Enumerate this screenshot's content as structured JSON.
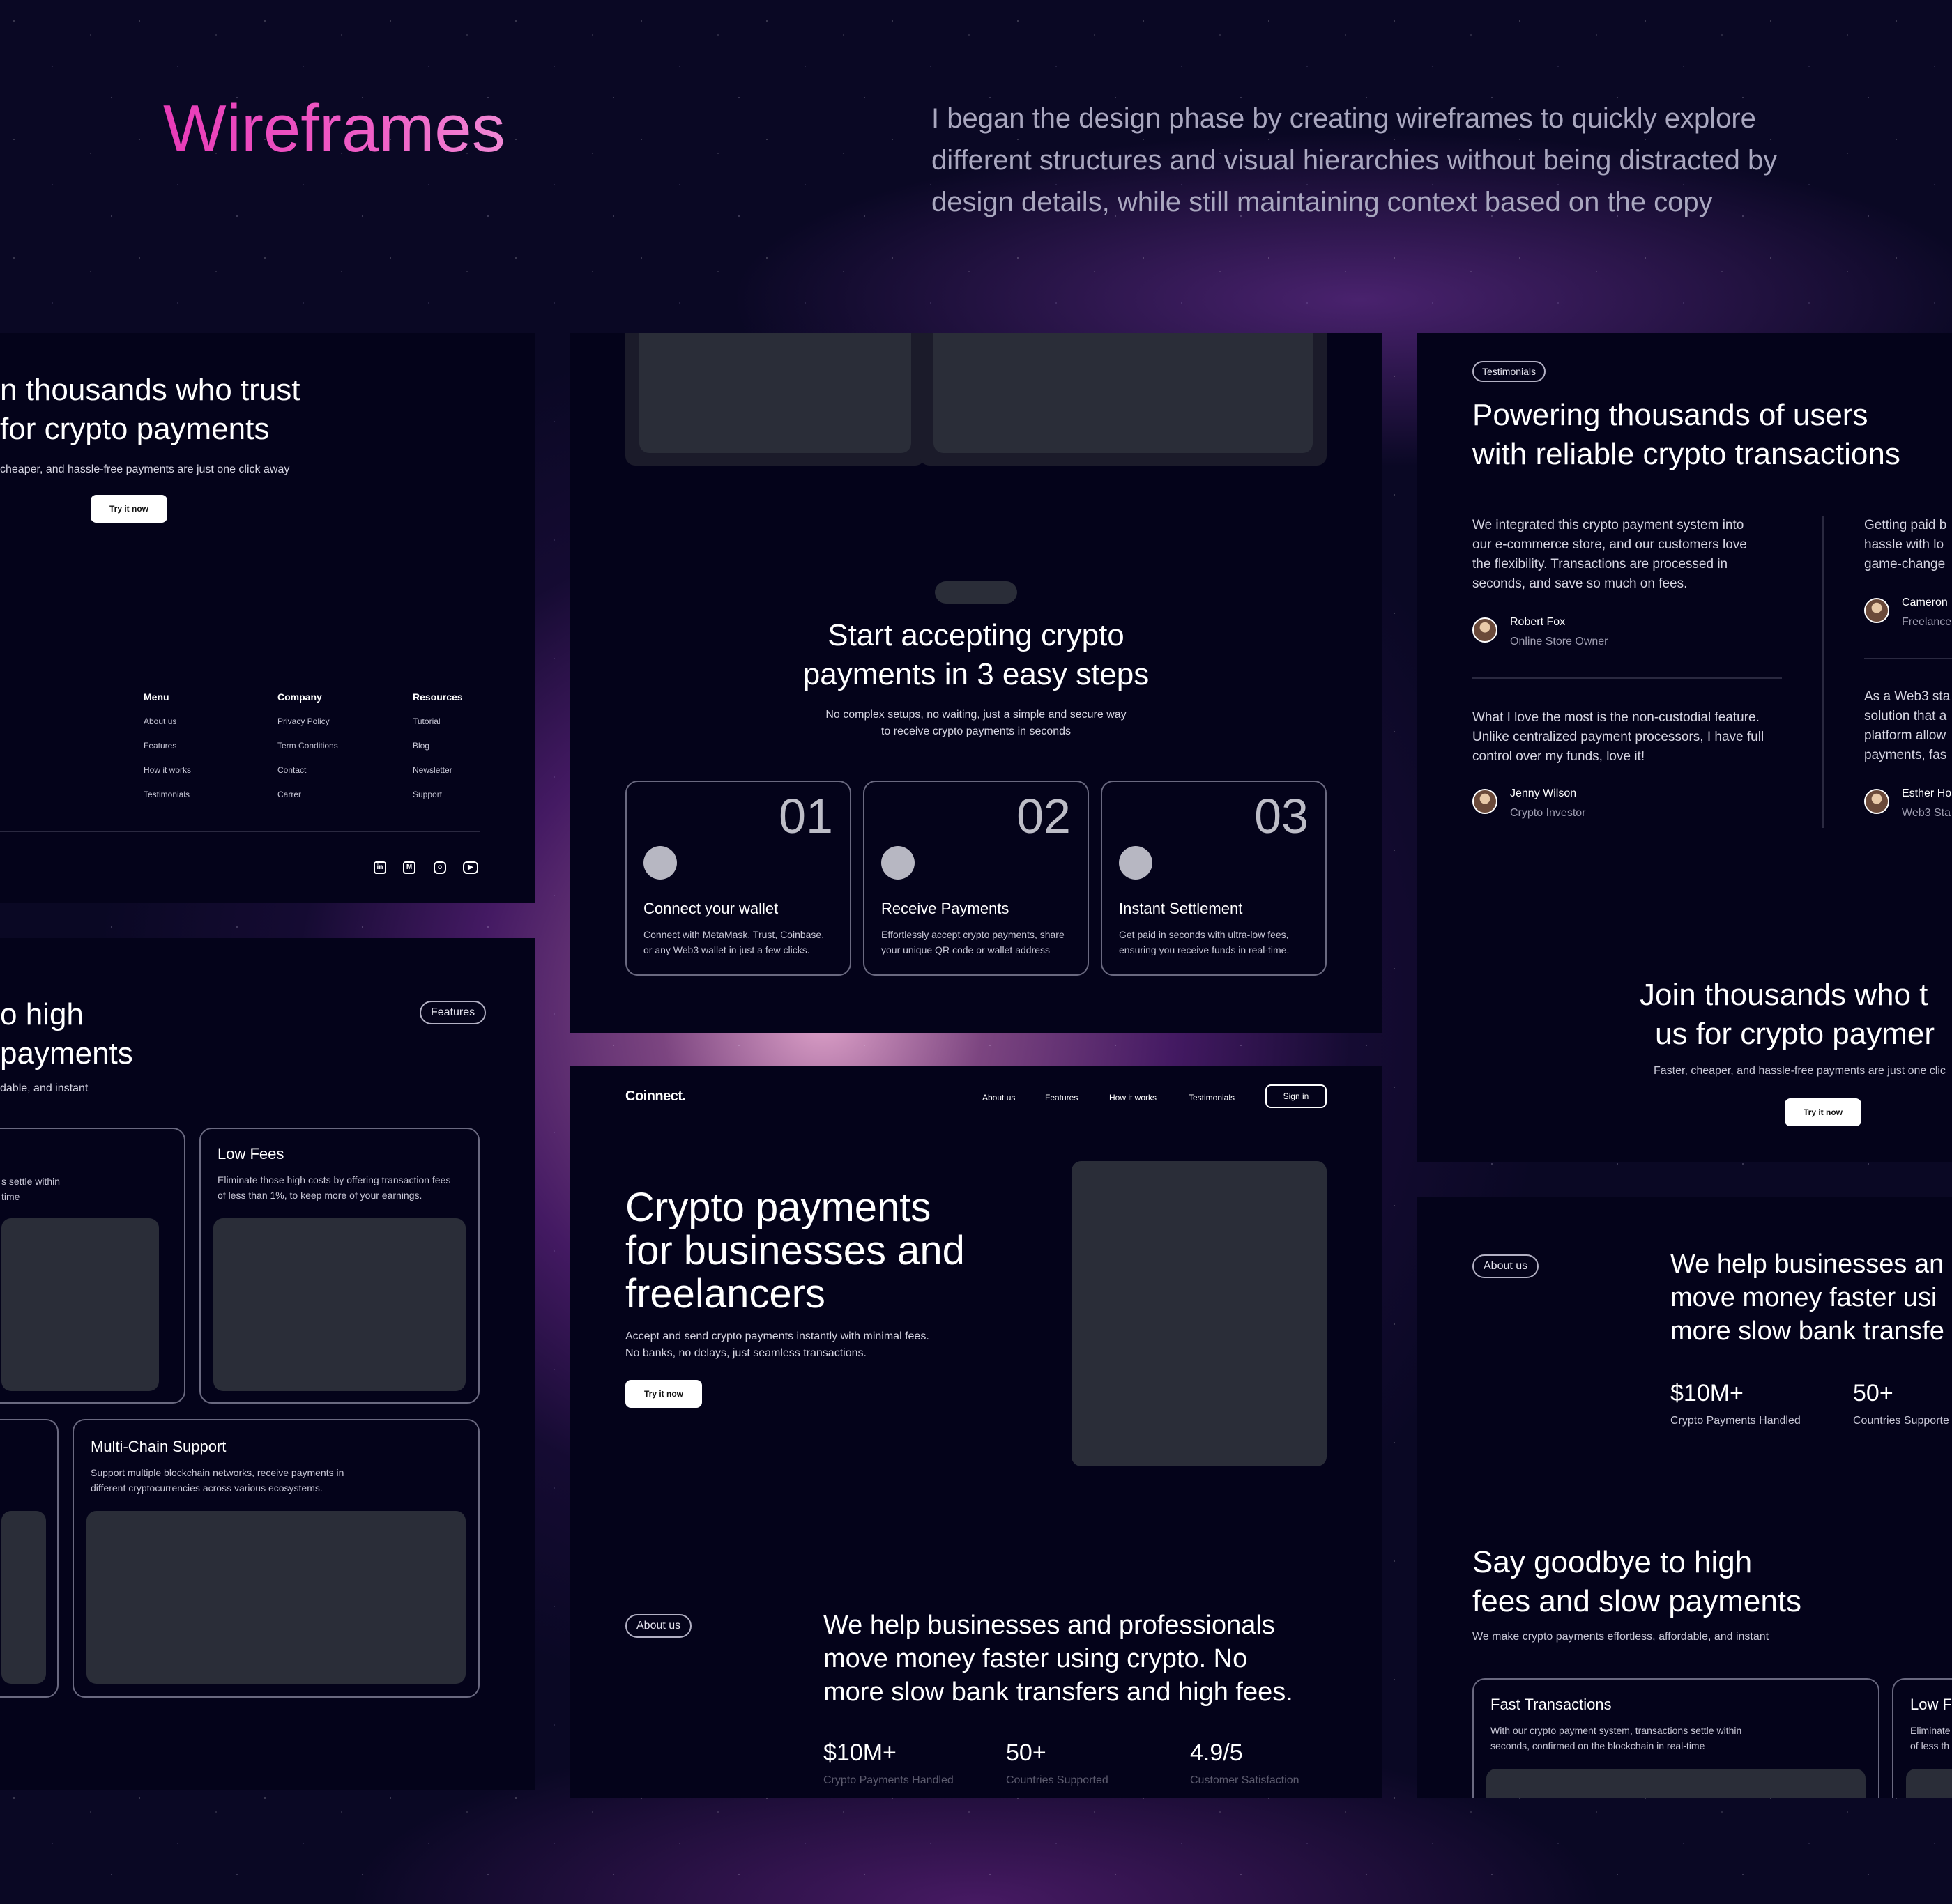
{
  "header": {
    "title": "Wireframes",
    "description": "I began the design phase by creating wireframes to quickly explore different structures and visual hierarchies without being distracted by design details, while still maintaining context based on the copy"
  },
  "cta_footer": {
    "title_line1": "n thousands who trust",
    "title_line2": " for crypto payments",
    "subtitle": "cheaper, and hassle-free payments are just one click away",
    "button": "Try it now",
    "columns": [
      {
        "title": "Menu",
        "links": [
          "About us",
          "Features",
          "How it works",
          "Testimonials"
        ]
      },
      {
        "title": "Company",
        "links": [
          "Privacy Policy",
          "Term Conditions",
          "Contact",
          "Carrer"
        ]
      },
      {
        "title": "Resources",
        "links": [
          "Tutorial",
          "Blog",
          "Newsletter",
          "Support"
        ]
      }
    ],
    "social_icons": [
      "linkedin-icon",
      "mail-icon",
      "instagram-icon",
      "youtube-icon"
    ]
  },
  "steps": {
    "title_line1": "Start accepting crypto",
    "title_line2": "payments in 3 easy steps",
    "subtitle_line1": "No complex setups, no waiting, just a simple and secure way",
    "subtitle_line2": "to receive crypto payments in seconds",
    "items": [
      {
        "num": "01",
        "title": "Connect your wallet",
        "desc1": "Connect with MetaMask, Trust, Coinbase,",
        "desc2": "or any Web3 wallet in just a few clicks."
      },
      {
        "num": "02",
        "title": "Receive Payments",
        "desc1": "Effortlessly accept crypto payments, share",
        "desc2": "your unique QR code or wallet address"
      },
      {
        "num": "03",
        "title": "Instant Settlement",
        "desc1": "Get paid in seconds with ultra-low fees,",
        "desc2": "ensuring you receive funds in real-time."
      }
    ]
  },
  "testimonials": {
    "badge": "Testimonials",
    "title_line1": "Powering thousands of users",
    "title_line2": "with reliable crypto transactions",
    "items": [
      {
        "q1": "We integrated this crypto payment system into",
        "q2": "our e-commerce store, and our customers love",
        "q3": "the flexibility. Transactions are processed in",
        "q4": "seconds, and save so much on fees.",
        "name": "Robert Fox",
        "role": "Online Store Owner"
      },
      {
        "q1": "What I love the most is the non-custodial feature.",
        "q2": "Unlike centralized payment processors, I have full",
        "q3": "control over my funds, love it!",
        "q4": "",
        "name": "Jenny Wilson",
        "role": "Crypto Investor"
      },
      {
        "q1": "Getting paid b",
        "q2": "hassle with lo",
        "q3": "game-change",
        "q4": "",
        "name": "Cameron",
        "role": "Freelance"
      },
      {
        "q1": "As a Web3 sta",
        "q2": "solution that a",
        "q3": "platform allow",
        "q4": "payments, fas",
        "name": "Esther Ho",
        "role": "Web3 Sta"
      }
    ],
    "join_line1": "Join thousands who t",
    "join_line2": "us for crypto paymer",
    "join_sub": "Faster, cheaper, and hassle-free payments are just one clic",
    "button": "Try it now"
  },
  "features_left": {
    "badge": "Features",
    "title_line1": "o high",
    "title_line2": "payments",
    "subtitle": "dable, and instant",
    "card1_desc1": "s settle within",
    "card1_desc2": " time",
    "card2_title": "Low Fees",
    "card2_desc1": "Eliminate those high costs by offering transaction fees",
    "card2_desc2": "of less than 1%, to keep more of your earnings.",
    "card3_title": "Multi-Chain Support",
    "card3_desc1": "Support multiple blockchain networks, receive payments in",
    "card3_desc2": "different cryptocurrencies across various ecosystems."
  },
  "hero": {
    "logo": "Coinnect.",
    "nav": [
      "About us",
      "Features",
      "How it works",
      "Testimonials"
    ],
    "signin": "Sign in",
    "title_line1": "Crypto payments",
    "title_line2": "for businesses and",
    "title_line3": "freelancers",
    "sub1": "Accept and send crypto payments instantly with minimal fees.",
    "sub2": "No banks, no delays, just seamless transactions.",
    "button": "Try it now",
    "about_badge": "About us",
    "about_line1": "We help businesses and professionals",
    "about_line2": "move money faster using crypto. No",
    "about_line3": "more slow bank transfers and high fees.",
    "stats": [
      {
        "value": "$10M+",
        "label": "Crypto Payments Handled"
      },
      {
        "value": "50+",
        "label": "Countries Supported"
      },
      {
        "value": "4.9/5",
        "label": "Customer Satisfaction"
      }
    ]
  },
  "about_right": {
    "badge": "About us",
    "line1": "We help businesses an",
    "line2": "move money faster usi",
    "line3": "more slow bank transfe",
    "stats": [
      {
        "value": "$10M+",
        "label": "Crypto Payments Handled"
      },
      {
        "value": "50+",
        "label": "Countries Supporte"
      }
    ],
    "goodbye_line1": "Say goodbye to high",
    "goodbye_line2": "fees and slow payments",
    "goodbye_sub": "We make crypto payments effortless, affordable, and instant",
    "card1_title": "Fast Transactions",
    "card1_desc1": "With our crypto payment system, transactions settle within",
    "card1_desc2": "seconds, confirmed on the blockchain in real-time",
    "card2_title": "Low F",
    "card2_desc1": "Eliminate",
    "card2_desc2": "of less th"
  }
}
